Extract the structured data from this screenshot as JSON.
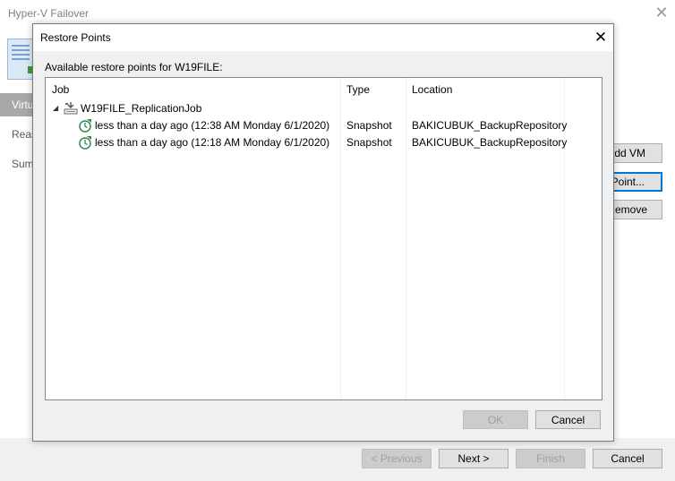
{
  "background_window": {
    "title": "Hyper-V Failover",
    "steps": [
      "Virtu",
      "Reas",
      "Sum"
    ],
    "side_buttons": [
      "Add VM",
      "Point...",
      "Remove"
    ],
    "footer_buttons": {
      "previous": "< Previous",
      "next": "Next >",
      "finish": "Finish",
      "cancel": "Cancel"
    }
  },
  "dialog": {
    "title": "Restore Points",
    "close_symbol": "✕",
    "label": "Available restore points for W19FILE:",
    "columns": [
      "Job",
      "Type",
      "Location"
    ],
    "job": {
      "name": "W19FILE_ReplicationJob",
      "expander_symbol": "◢",
      "icon": "replication-job-icon"
    },
    "restore_points": [
      {
        "name": "less than a day ago (12:38 AM Monday 6/1/2020)",
        "type": "Snapshot",
        "location": "BAKICUBUK_BackupRepository",
        "icon": "restore-point-icon"
      },
      {
        "name": "less than a day ago (12:18 AM Monday 6/1/2020)",
        "type": "Snapshot",
        "location": "BAKICUBUK_BackupRepository",
        "icon": "restore-point-icon"
      }
    ],
    "buttons": {
      "ok": "OK",
      "cancel": "Cancel"
    }
  },
  "colors": {
    "dialog_background": "#f0f0f0",
    "focus_border": "#0078d7",
    "disabled_text": "#a0a0a0",
    "restore_point_icon": "#2e8b57"
  }
}
